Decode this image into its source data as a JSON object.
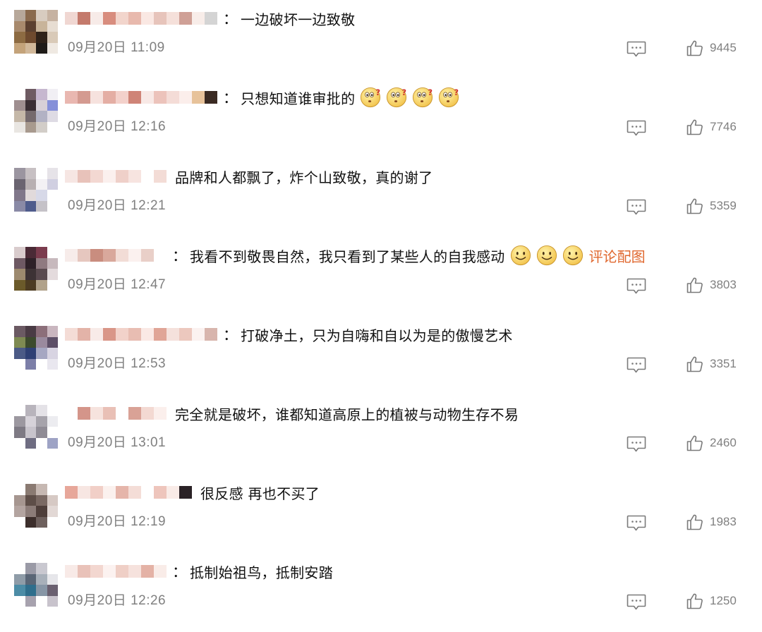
{
  "comments": [
    {
      "text": "一边破坏一边致敬",
      "colon": "：",
      "date": "09月20日",
      "time": "11:09",
      "likes": "9445",
      "emojis": [],
      "link": "",
      "avatar_colors": [
        "#b7a89a",
        "#8a6a4d",
        "#d8ccc0",
        "#c6b2a1",
        "#a88a6d",
        "#5b4030",
        "#c8b49a",
        "#e7ddd2",
        "#8d6b42",
        "#6e4a2e",
        "#2f2219",
        "#d9cab8",
        "#c4a37a",
        "#d1b89a",
        "#1f1b18",
        "#efe9e2"
      ],
      "username_colors": [
        "#f0d7d2",
        "#c47a6c",
        "#f7ebe8",
        "#d88d7e",
        "#f2d5cc",
        "#e8b9ad",
        "#fae8e3",
        "#e7c4bb",
        "#f5e0da",
        "#cfa096",
        "#f8ede9",
        "#d4d4d4"
      ]
    },
    {
      "text": "只想知道谁审批的",
      "colon": "：",
      "date": "09月20日",
      "time": "12:16",
      "likes": "7746",
      "emojis": [
        "think",
        "think",
        "think",
        "think"
      ],
      "link": "",
      "avatar_colors": [
        "#ffffff",
        "#6e5b62",
        "#c6b7cf",
        "#f1eff4",
        "#9f8f90",
        "#3a2e33",
        "#d7d0d7",
        "#8590d9",
        "#c5b8a8",
        "#756a6d",
        "#b2b2c4",
        "#dedbe4",
        "#e9e6e2",
        "#a89a8e",
        "#d2cdc8",
        "#ffffff"
      ],
      "username_colors": [
        "#e9b7b0",
        "#d49a90",
        "#f6e2de",
        "#e4aea4",
        "#f3d1cb",
        "#cf8477",
        "#f8e9e6",
        "#ecc3bb",
        "#f4dcd7",
        "#fbeeeb",
        "#e7c29a",
        "#3a2a22"
      ]
    },
    {
      "text": "品牌和人都飘了，炸个山致敬，真的谢了",
      "colon": "",
      "date": "09月20日",
      "time": "12:21",
      "likes": "5359",
      "emojis": [],
      "link": "",
      "avatar_colors": [
        "#9b95a0",
        "#c7c0c3",
        "#ffffff",
        "#e6e3e8",
        "#6a6470",
        "#b8b0b2",
        "#f3f1f4",
        "#d0cfe1",
        "#80778a",
        "#e1dadb",
        "#d7d9e8",
        "#ffffff",
        "#8a8aa6",
        "#4f5c8c",
        "#c5c2c8",
        "#ffffff"
      ],
      "username_colors": [
        "#f6e6e3",
        "#e8c2ba",
        "#f3d8d2",
        "#fbf0ee",
        "#efd0c9",
        "#f7e4e0",
        "#ffffff",
        "#f3dcd6"
      ]
    },
    {
      "text": "我看不到敬畏自然，我只看到了某些人的自我感动",
      "colon": "：",
      "date": "09月20日",
      "time": "12:47",
      "likes": "3803",
      "emojis": [
        "smile",
        "smile",
        "smile"
      ],
      "link": "评论配图",
      "avatar_colors": [
        "#d9cccd",
        "#4a2a36",
        "#7b3c4e",
        "#ffffff",
        "#6e5963",
        "#2e2128",
        "#8f7a80",
        "#c7b9bd",
        "#9d8a6f",
        "#3d3235",
        "#5a4a4f",
        "#e4dbdd",
        "#6b5a2a",
        "#4d3c22",
        "#b1a28a",
        "#ffffff"
      ],
      "username_colors": [
        "#f7ecea",
        "#e6c7bf",
        "#c98d7f",
        "#d9a89c",
        "#f2dcd6",
        "#fbf1ef",
        "#e9cfc8",
        "#ffffff"
      ]
    },
    {
      "text": "打破净土，只为自嗨和自以为是的傲慢艺术",
      "colon": "：",
      "date": "09月20日",
      "time": "12:53",
      "likes": "3351",
      "emojis": [],
      "link": "",
      "avatar_colors": [
        "#6b5a63",
        "#4a3b44",
        "#8c6f7a",
        "#c9b6bf",
        "#7e8a52",
        "#3c4a2c",
        "#9a8a9e",
        "#5d4f67",
        "#4b5a86",
        "#2e3f74",
        "#a6a7c2",
        "#d8d4e2",
        "#ffffff",
        "#7c7fa8",
        "#ffffff",
        "#e9e7ef"
      ],
      "username_colors": [
        "#f4dcd6",
        "#e3b3a8",
        "#f8ebe8",
        "#d99688",
        "#f2d2ca",
        "#e8bdb2",
        "#fae9e5",
        "#e0a597",
        "#f5e1dc",
        "#ecc8be",
        "#fbf2f0",
        "#d8b5ad"
      ]
    },
    {
      "text": "完全就是破坏，谁都知道高原上的植被与动物生存不易",
      "colon": "",
      "date": "09月20日",
      "time": "13:01",
      "likes": "2460",
      "emojis": [],
      "link": "",
      "avatar_colors": [
        "#ffffff",
        "#b8b4bc",
        "#e4e2e7",
        "#ffffff",
        "#9c98a0",
        "#d6d2d9",
        "#a6a3ab",
        "#ececf0",
        "#7e7a84",
        "#c8c4cc",
        "#8f8b95",
        "#ffffff",
        "#ffffff",
        "#6f6d82",
        "#ffffff",
        "#9ea3c5"
      ],
      "username_colors": [
        "#ffffff",
        "#d4958a",
        "#f6e3de",
        "#e9c0b6",
        "#ffffff",
        "#d9a296",
        "#f3d9d2",
        "#fbefec"
      ]
    },
    {
      "text": "很反感 再也不买了",
      "colon": "",
      "date": "09月20日",
      "time": "12:19",
      "likes": "1983",
      "emojis": [],
      "link": "",
      "avatar_colors": [
        "#ffffff",
        "#8a7a72",
        "#c6b8b2",
        "#ffffff",
        "#a69690",
        "#5e4e48",
        "#7a6963",
        "#d6c9c4",
        "#b3a4a0",
        "#8c7c78",
        "#4e3e3a",
        "#e2d8d5",
        "#ffffff",
        "#3c2e2b",
        "#6e605d",
        "#ffffff"
      ],
      "username_colors": [
        "#e7a79a",
        "#f7e6e2",
        "#f1cfc7",
        "#fbf1ee",
        "#e5b5aa",
        "#f4ddd7",
        "#ffffff",
        "#eec5bc",
        "#f9ebe7",
        "#2a2226"
      ]
    },
    {
      "text": "抵制始祖鸟，抵制安踏",
      "colon": "：",
      "date": "09月20日",
      "time": "12:26",
      "likes": "1250",
      "emojis": [],
      "link": "",
      "avatar_colors": [
        "#ffffff",
        "#9a9aa6",
        "#c9c8d0",
        "#ffffff",
        "#8f9ca8",
        "#5a6676",
        "#a8b0ba",
        "#e6e6ea",
        "#4c8ca6",
        "#2f6e8c",
        "#8796a6",
        "#6a6070",
        "#ffffff",
        "#a7a2ae",
        "#ffffff",
        "#c8c3cc"
      ],
      "username_colors": [
        "#f8eae7",
        "#e9c2b9",
        "#f3d7d0",
        "#fcf2f0",
        "#efcfc6",
        "#f6e2dd",
        "#e4b2a6",
        "#f9ece8"
      ]
    }
  ],
  "icons": {
    "reply": "comment-bubble-icon",
    "like": "thumbs-up-icon"
  },
  "colors": {
    "meta_text": "#808080",
    "link": "#e0682f",
    "icon_stroke": "#7a7a7a"
  }
}
